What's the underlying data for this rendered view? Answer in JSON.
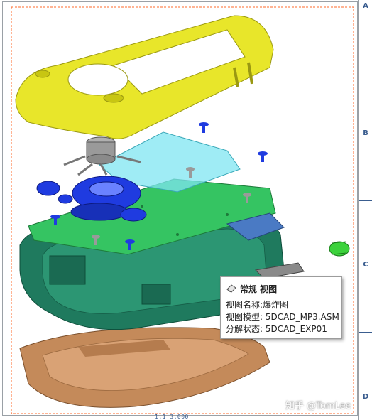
{
  "tooltip": {
    "title": "常规 视图",
    "rows": [
      {
        "label": "视图名称:",
        "value": "爆炸图"
      },
      {
        "label": "视图模型:",
        "value": "5DCAD_MP3.ASM"
      },
      {
        "label": "分解状态:",
        "value": "5DCAD_EXP01"
      }
    ]
  },
  "ruler": {
    "labels": [
      "A",
      "B",
      "C",
      "D"
    ]
  },
  "scale_label": "1:1 3.000",
  "watermark": "知乎 @TomLee",
  "icons": {
    "view_icon": "eraser-view-icon"
  },
  "colors": {
    "yellow_bezel": "#e8e62a",
    "cyan_window": "#7fe6f2",
    "green_pcb": "#35c462",
    "teal_body": "#1f7a5e",
    "bronze_cover": "#c48a5a",
    "blue_parts": "#1f3be0",
    "ruler_blue": "#3a5d8f"
  }
}
